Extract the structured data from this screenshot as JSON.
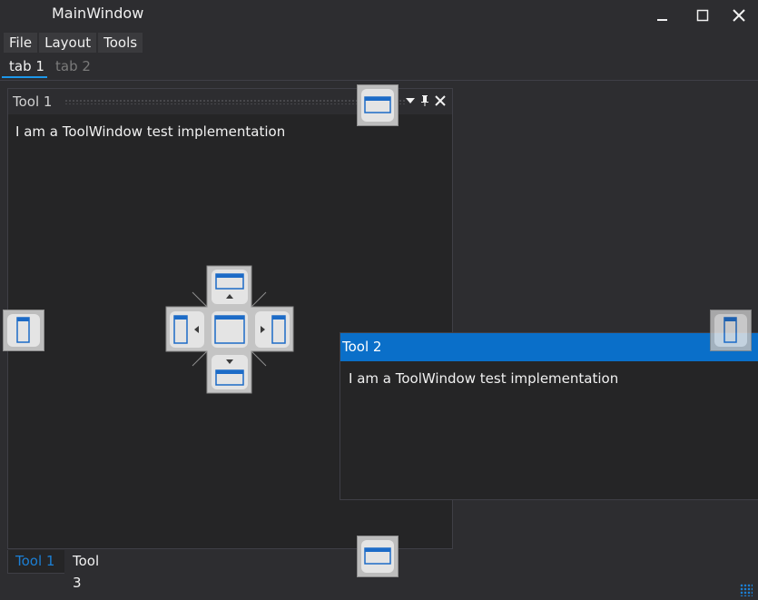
{
  "window": {
    "title": "MainWindow",
    "minimize_glyph": "–",
    "maximize_glyph": "☐",
    "close_glyph": "✕"
  },
  "menu": [
    "File",
    "Layout",
    "Tools"
  ],
  "document_tabs": [
    "tab 1",
    "tab 2"
  ],
  "tool1": {
    "title": "Tool 1",
    "content": "I am a ToolWindow test implementation"
  },
  "tool2": {
    "title": "Tool 2",
    "content": "I am a ToolWindow test implementation"
  },
  "bottom_tabs": [
    "Tool 1",
    "Tool 3"
  ],
  "colors": {
    "accent": "#0a6fc9",
    "background": "#2d2d30",
    "pane_background": "#252526"
  },
  "icons": {
    "dock_top": "dock-top-icon",
    "dock_left": "dock-left-icon",
    "dock_right": "dock-right-icon",
    "dock_bottom": "dock-bottom-icon",
    "dock_center": "dock-center-icon"
  }
}
